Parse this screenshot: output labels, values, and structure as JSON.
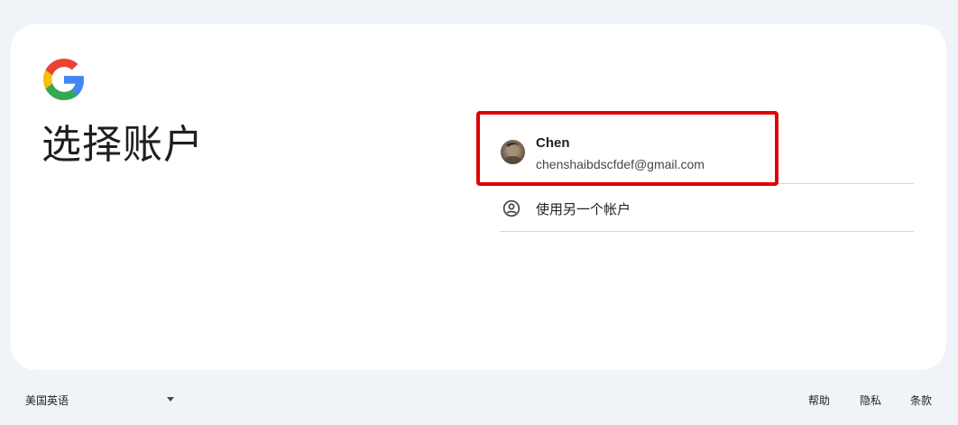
{
  "page": {
    "title": "选择账户"
  },
  "brand": {
    "logo_icon": "google-g-logo-icon",
    "colors": {
      "blue": "#4285F4",
      "red": "#EA4335",
      "yellow": "#FBBC05",
      "green": "#34A853"
    }
  },
  "accounts": [
    {
      "name": "Chen",
      "email": "chenshaibdscfdef@gmail.com",
      "avatar_icon": "user-avatar"
    }
  ],
  "use_another": {
    "label": "使用另一个帐户",
    "icon": "person-circle-icon"
  },
  "highlight_color": "#e00000",
  "footer": {
    "language": "美国英语",
    "links": {
      "help": "帮助",
      "privacy": "隐私",
      "terms": "条款"
    }
  }
}
